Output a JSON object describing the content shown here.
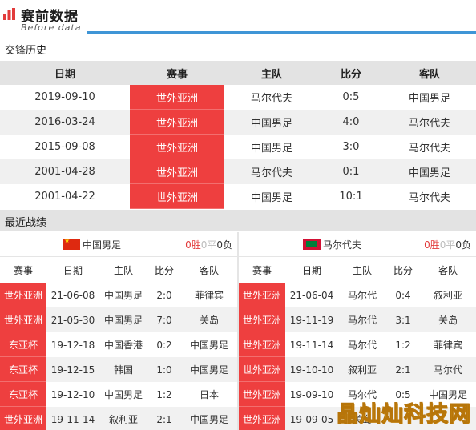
{
  "header": {
    "title": "赛前数据",
    "subtitle": "Before data"
  },
  "h2h": {
    "label": "交锋历史",
    "columns": [
      "日期",
      "赛事",
      "主队",
      "比分",
      "客队"
    ],
    "rows": [
      {
        "date": "2019-09-10",
        "event": "世外亚洲",
        "home": "马尔代夫",
        "score": "0:5",
        "away": "中国男足"
      },
      {
        "date": "2016-03-24",
        "event": "世外亚洲",
        "home": "中国男足",
        "score": "4:0",
        "away": "马尔代夫"
      },
      {
        "date": "2015-09-08",
        "event": "世外亚洲",
        "home": "中国男足",
        "score": "3:0",
        "away": "马尔代夫"
      },
      {
        "date": "2001-04-28",
        "event": "世外亚洲",
        "home": "马尔代夫",
        "score": "0:1",
        "away": "中国男足"
      },
      {
        "date": "2001-04-22",
        "event": "世外亚洲",
        "home": "中国男足",
        "score": "10:1",
        "away": "马尔代夫"
      }
    ]
  },
  "recent": {
    "label": "最近战绩",
    "columns": [
      "赛事",
      "日期",
      "主队",
      "比分",
      "客队"
    ],
    "left": {
      "team": "中国男足",
      "record": {
        "win": "0胜",
        "draw": "0平",
        "loss": "0负"
      },
      "rows": [
        {
          "event": "世外亚洲",
          "date": "21-06-08",
          "home": "中国男足",
          "score": "2:0",
          "away": "菲律宾"
        },
        {
          "event": "世外亚洲",
          "date": "21-05-30",
          "home": "中国男足",
          "score": "7:0",
          "away": "关岛"
        },
        {
          "event": "东亚杯",
          "date": "19-12-18",
          "home": "中国香港",
          "score": "0:2",
          "away": "中国男足"
        },
        {
          "event": "东亚杯",
          "date": "19-12-15",
          "home": "韩国",
          "score": "1:0",
          "away": "中国男足"
        },
        {
          "event": "东亚杯",
          "date": "19-12-10",
          "home": "中国男足",
          "score": "1:2",
          "away": "日本"
        },
        {
          "event": "世外亚洲",
          "date": "19-11-14",
          "home": "叙利亚",
          "score": "2:1",
          "away": "中国男足"
        }
      ]
    },
    "right": {
      "team": "马尔代夫",
      "record": {
        "win": "0胜",
        "draw": "0平",
        "loss": "0负"
      },
      "rows": [
        {
          "event": "世外亚洲",
          "date": "21-06-04",
          "home": "马尔代",
          "score": "0:4",
          "away": "叙利亚"
        },
        {
          "event": "世外亚洲",
          "date": "19-11-19",
          "home": "马尔代",
          "score": "3:1",
          "away": "关岛"
        },
        {
          "event": "世外亚洲",
          "date": "19-11-14",
          "home": "马尔代",
          "score": "1:2",
          "away": "菲律宾"
        },
        {
          "event": "世外亚洲",
          "date": "19-10-10",
          "home": "叙利亚",
          "score": "2:1",
          "away": "马尔代"
        },
        {
          "event": "世外亚洲",
          "date": "19-09-10",
          "home": "马尔代",
          "score": "0:5",
          "away": "中国男足"
        },
        {
          "event": "世外亚洲",
          "date": "19-09-05",
          "home": "关岛",
          "score": "",
          "away": ""
        }
      ]
    }
  },
  "watermark": "晶灿灿科技网",
  "colors": {
    "accent": "#3f95d6",
    "event_red": "#ee3f3f",
    "win": "#e23b3b"
  }
}
